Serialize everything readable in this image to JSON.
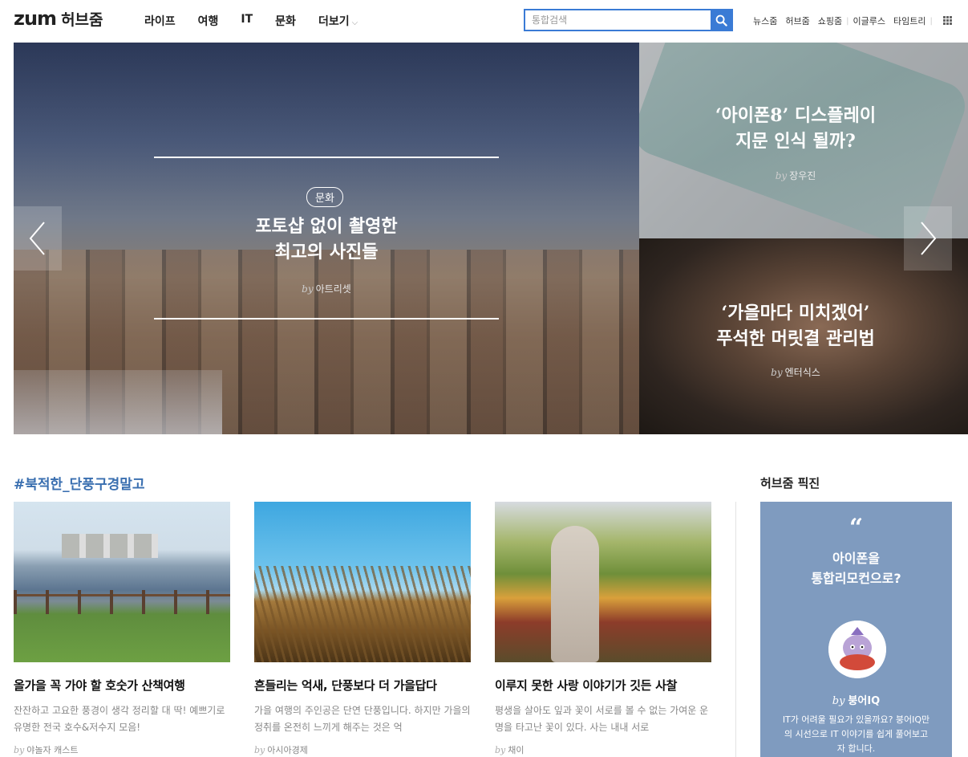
{
  "header": {
    "logo_brand": "zum",
    "logo_sub": "허브줌",
    "nav": [
      "라이프",
      "여행",
      "IT",
      "문화",
      "더보기"
    ],
    "more_chevron": "⌵",
    "search": {
      "placeholder": "통합검색",
      "value": ""
    },
    "util_links": [
      "뉴스줌",
      "허브줌",
      "쇼핑줌",
      "이글루스",
      "타임트리"
    ],
    "icons": [
      "search-icon",
      "grid-menu-icon"
    ]
  },
  "hero": {
    "main": {
      "category": "문화",
      "title_line1": "포토샵 없이 촬영한",
      "title_line2": "최고의 사진들",
      "by": "by",
      "author": "아트리셋"
    },
    "side": [
      {
        "title_line1": "‘아이폰8’ 디스플레이",
        "title_line2": "지문 인식 될까?",
        "by": "by",
        "author": "장우진"
      },
      {
        "title_line1": "‘가을마다 미치겠어’",
        "title_line2": "푸석한 머릿결 관리법",
        "by": "by",
        "author": "엔터식스"
      }
    ],
    "icons": [
      "chevron-left-icon",
      "chevron-right-icon"
    ]
  },
  "section": {
    "tag": "#북적한_단풍구경말고",
    "cards": [
      {
        "title": "올가을 꼭 가야 할 호숫가 산책여행",
        "desc": "잔잔하고 고요한 풍경이 생각 정리할 대 딱! 예쁘기로 유명한 전국 호수&저수지 모음!",
        "by": "by",
        "author": "야놀자 캐스트"
      },
      {
        "title": "흔들리는 억새, 단풍보다 더 가을답다",
        "desc": "가을 여행의 주인공은 단연 단풍입니다. 하지만 가을의 정취를 온전히 느끼게 해주는 것은 억",
        "by": "by",
        "author": "아시아경제"
      },
      {
        "title": "이루지 못한 사랑 이야기가 깃든 사찰",
        "desc": "평생을 살아도 잎과 꽃이 서로를 볼 수 없는 가여운 운명을 타고난 꽃이 있다. 사는 내내 서로",
        "by": "by",
        "author": "채이"
      }
    ]
  },
  "pick": {
    "heading": "허브줌 픽진",
    "quote_mark": "“",
    "title_line1": "아이폰을",
    "title_line2": "통합리모컨으로?",
    "by": "by",
    "author": "붕어IQ",
    "desc": "IT가 어려울 필요가 있을까요? 붕어IQ만의 시선으로 IT 이야기를 쉽게 풀어보고자 합니다."
  },
  "colors": {
    "accent": "#3a7bd5",
    "tag": "#3a6fb0",
    "pick_bg": "#7f9bbf"
  }
}
